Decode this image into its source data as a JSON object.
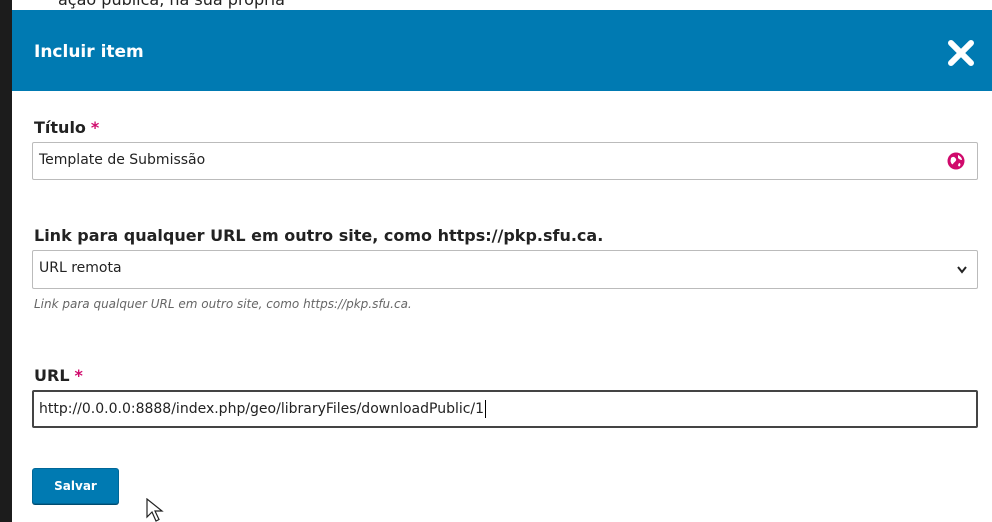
{
  "background": {
    "partial_text": "ação pública, na sua própria"
  },
  "modal": {
    "title": "Incluir item",
    "close_icon": "close-x-icon",
    "header_color": "#007ab2"
  },
  "form": {
    "title_field": {
      "label": "Título",
      "required_marker": "*",
      "value": "Template de Submissão",
      "locale_icon": "globe-icon"
    },
    "link_field": {
      "label": "Link para qualquer URL em outro site, como https://pkp.sfu.ca.",
      "selected_option": "URL remota",
      "help_text": "Link para qualquer URL em outro site, como https://pkp.sfu.ca."
    },
    "url_field": {
      "label": "URL",
      "required_marker": "*",
      "value": "http://0.0.0.0:8888/index.php/geo/libraryFiles/downloadPublic/1"
    },
    "save_label": "Salvar"
  },
  "colors": {
    "primary": "#007ab2",
    "required": "#d00a6c"
  }
}
